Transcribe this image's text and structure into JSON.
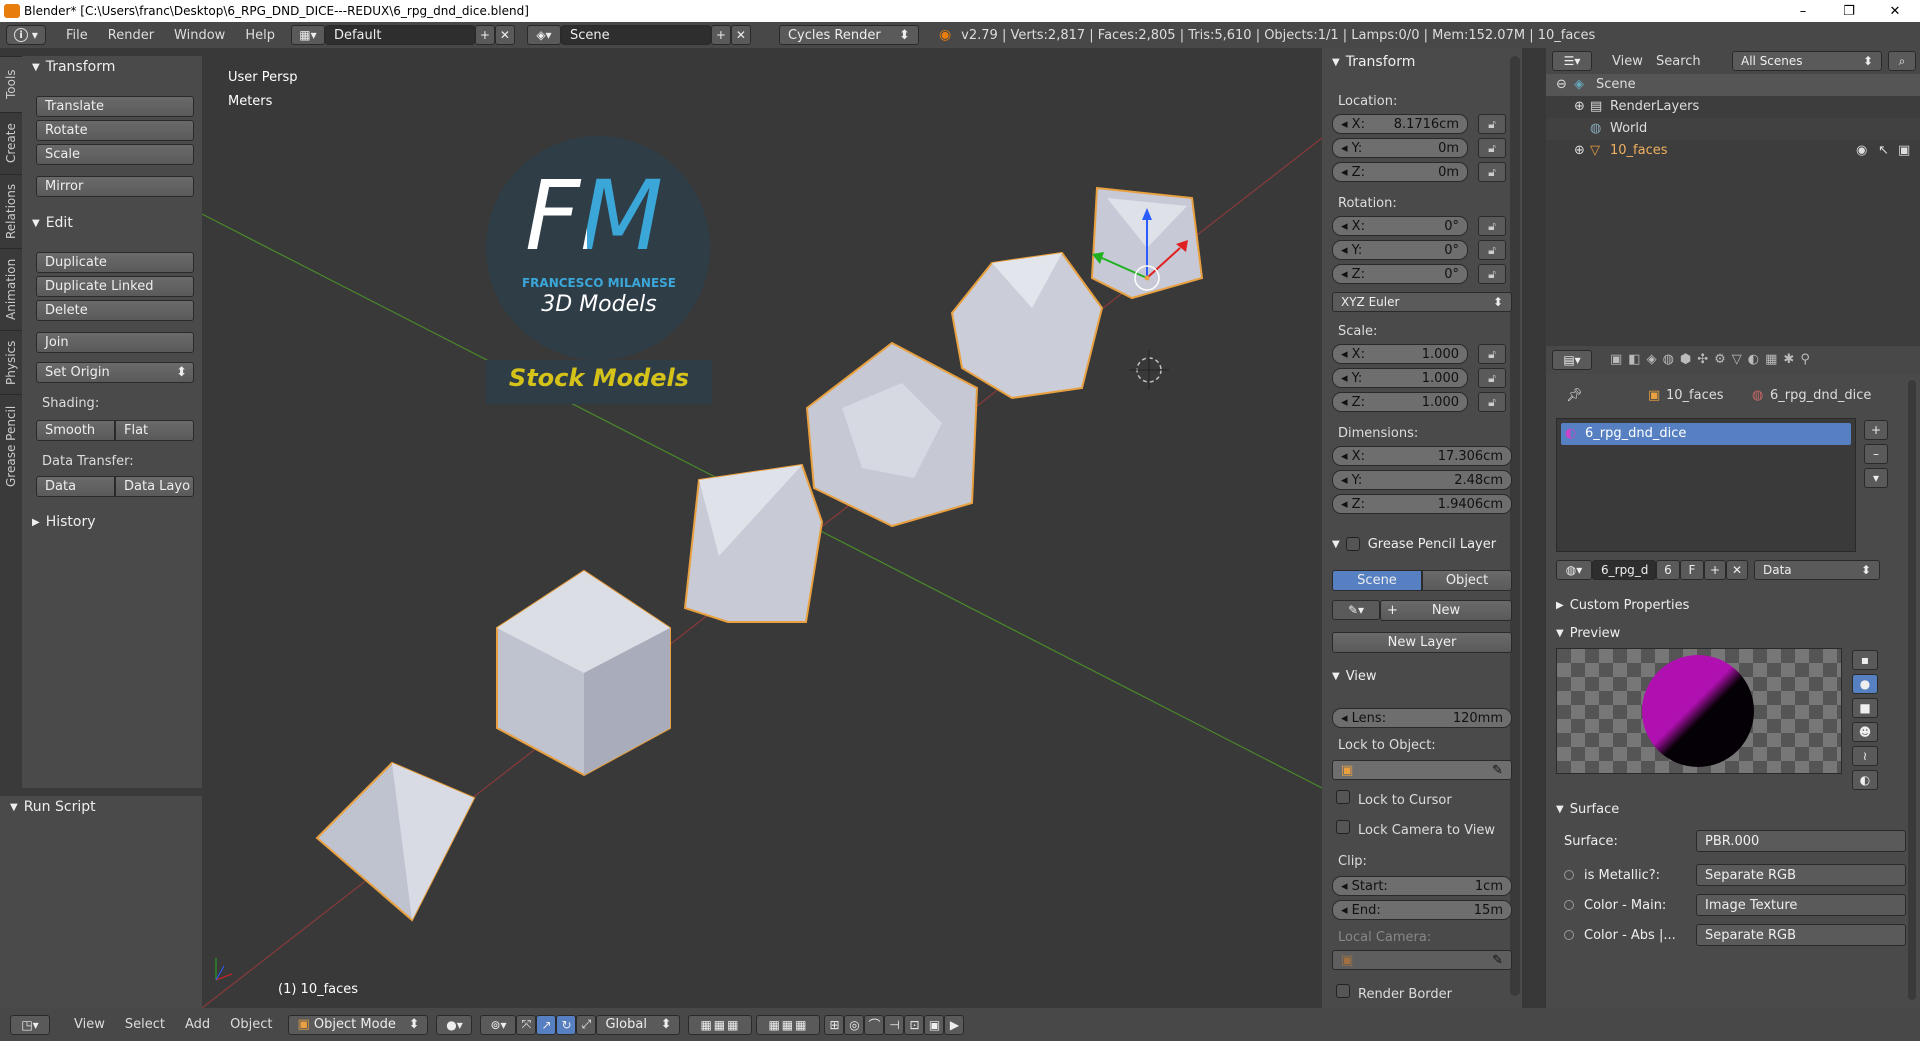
{
  "titlebar": {
    "title": "Blender* [C:\\Users\\franc\\Desktop\\6_RPG_DND_DICE---REDUX\\6_rpg_dnd_dice.blend]",
    "minimize": "–",
    "maximize": "❐",
    "close": "✕"
  },
  "topbar": {
    "info_icon": "i",
    "menus": [
      "File",
      "Render",
      "Window",
      "Help"
    ],
    "layout": "Default",
    "scene": "Scene",
    "engine": "Cycles Render",
    "stats": "v2.79 | Verts:2,817 | Faces:2,805 | Tris:5,610 | Objects:1/1 | Lamps:0/0 | Mem:152.07M | 10_faces"
  },
  "toolshelf": {
    "tabs": [
      "Tools",
      "Create",
      "Relations",
      "Animation",
      "Physics",
      "Grease Pencil"
    ],
    "transform_header": "Transform",
    "transform_buttons": [
      "Translate",
      "Rotate",
      "Scale",
      "Mirror"
    ],
    "edit_header": "Edit",
    "edit_buttons": [
      "Duplicate",
      "Duplicate Linked",
      "Delete",
      "Join",
      "Set Origin"
    ],
    "shading_label": "Shading:",
    "smooth": "Smooth",
    "flat": "Flat",
    "data_transfer_label": "Data Transfer:",
    "data": "Data",
    "data_layo": "Data Layo",
    "history_header": "History",
    "run_script_header": "Run Script"
  },
  "viewport": {
    "view_name": "User Persp",
    "units": "Meters",
    "object_label": "(1) 10_faces",
    "logo_fm": "FM",
    "logo_name": "FRANCESCO MILANESE",
    "logo_sub": "3D Models",
    "stock": "Stock Models"
  },
  "npanel": {
    "transform_header": "Transform",
    "location_label": "Location:",
    "location": {
      "x": "8.1716cm",
      "y": "0m",
      "z": "0m"
    },
    "rotation_label": "Rotation:",
    "rotation": {
      "x": "0°",
      "y": "0°",
      "z": "0°"
    },
    "rotation_mode": "XYZ Euler",
    "scale_label": "Scale:",
    "scale": {
      "x": "1.000",
      "y": "1.000",
      "z": "1.000"
    },
    "dimensions_label": "Dimensions:",
    "dimensions": {
      "x": "17.306cm",
      "y": "2.48cm",
      "z": "1.9406cm"
    },
    "axis_x": "X:",
    "axis_y": "Y:",
    "axis_z": "Z:",
    "gp_header": "Grease Pencil Layer",
    "gp_scene": "Scene",
    "gp_object": "Object",
    "gp_new": "New",
    "gp_new_layer": "New Layer",
    "view_header": "View",
    "lens_label": "Lens:",
    "lens": "120mm",
    "lock_to_object": "Lock to Object:",
    "lock_to_cursor": "Lock to Cursor",
    "lock_camera": "Lock Camera to View",
    "clip_label": "Clip:",
    "clip_start_label": "Start:",
    "clip_start": "1cm",
    "clip_end_label": "End:",
    "clip_end": "15m",
    "local_camera": "Local Camera:",
    "render_border": "Render Border"
  },
  "outliner": {
    "view": "View",
    "search": "Search",
    "all_scenes": "All Scenes",
    "items": [
      "Scene",
      "RenderLayers",
      "World",
      "10_faces"
    ]
  },
  "properties": {
    "breadcrumb_object": "10_faces",
    "breadcrumb_material": "6_rpg_dnd_dice",
    "material_slot": "6_rpg_dnd_dice",
    "mat_name": "6_rpg_d",
    "mat_users": "6",
    "mat_fake": "F",
    "link": "Data",
    "custom_props": "Custom Properties",
    "preview": "Preview",
    "surface_header": "Surface",
    "surface_label": "Surface:",
    "surface_value": "PBR.000",
    "nodes": [
      {
        "label": "is Metallic?:",
        "value": "Separate RGB"
      },
      {
        "label": "Color - Main:",
        "value": "Image Texture"
      },
      {
        "label": "Color - Abs |...",
        "value": "Separate RGB"
      }
    ]
  },
  "bottombar": {
    "menus": [
      "View",
      "Select",
      "Add",
      "Object"
    ],
    "mode": "Object Mode",
    "orientation": "Global"
  },
  "colors": {
    "selection_outline": "#e8a040",
    "accent_blue": "#5680c2",
    "logo_yellow": "#d6c31a",
    "logo_cyan": "#3aa7d8"
  }
}
